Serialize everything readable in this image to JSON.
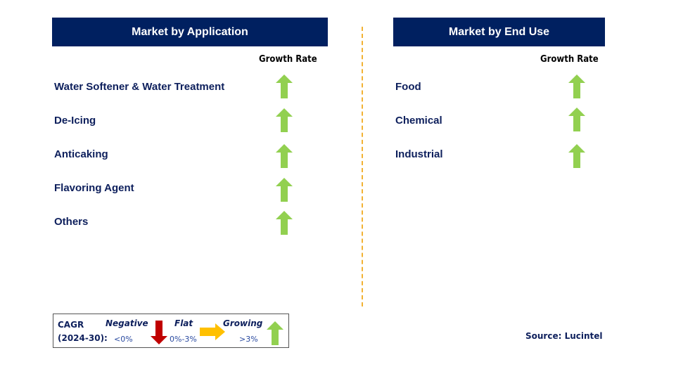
{
  "application": {
    "title": "Market by Application",
    "growth_label": "Growth Rate",
    "items": [
      {
        "label": "Water Softener & Water Treatment",
        "trend": "growing"
      },
      {
        "label": "De-Icing",
        "trend": "growing"
      },
      {
        "label": "Anticaking",
        "trend": "growing"
      },
      {
        "label": "Flavoring Agent",
        "trend": "growing"
      },
      {
        "label": "Others",
        "trend": "growing"
      }
    ]
  },
  "end_use": {
    "title": "Market by End Use",
    "growth_label": "Growth Rate",
    "items": [
      {
        "label": "Food",
        "trend": "growing"
      },
      {
        "label": "Chemical",
        "trend": "growing"
      },
      {
        "label": "Industrial",
        "trend": "growing"
      }
    ]
  },
  "legend": {
    "cagr_label": "CAGR",
    "period": "(2024-30):",
    "negative": {
      "label": "Negative",
      "range": "<0%",
      "color": "#c00000",
      "icon": "down-arrow"
    },
    "flat": {
      "label": "Flat",
      "range": "0%-3%",
      "color": "#ffc000",
      "icon": "right-arrow"
    },
    "growing": {
      "label": "Growing",
      "range": ">3%",
      "color": "#92d050",
      "icon": "up-arrow"
    }
  },
  "source": "Source: Lucintel",
  "colors": {
    "header_bg": "#002060",
    "text": "#0d1f5c",
    "divider": "#f2b233"
  }
}
